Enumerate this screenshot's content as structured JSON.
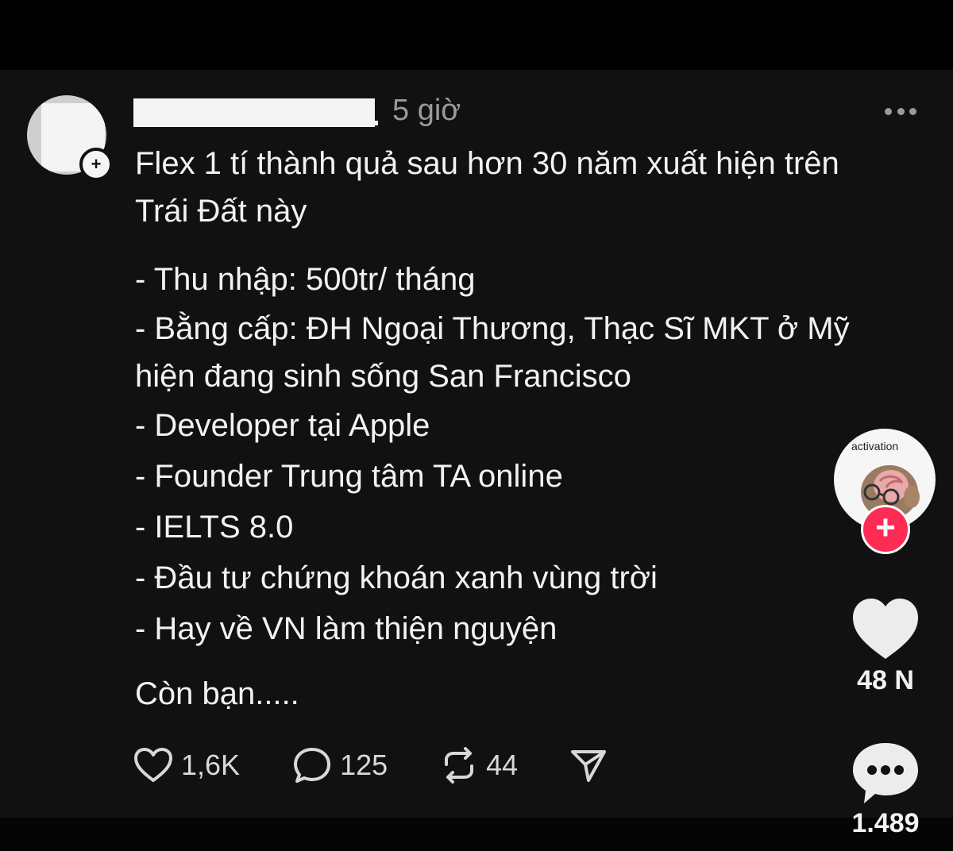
{
  "post": {
    "time": "5 giờ",
    "title_lines": [
      "Flex 1 tí thành quả sau hơn 30 năm xuất hiện trên",
      "Trái Đất này"
    ],
    "list_lines": [
      "- Thu nhập: 500tr/ tháng",
      "- Bằng cấp: ĐH Ngoại Thương, Thạc Sĩ MKT ở Mỹ",
      "hiện đang sinh sống San Francisco",
      "- Developer tại Apple",
      "- Founder Trung tâm TA online",
      "- IELTS 8.0",
      "- Đầu tư chứng khoán xanh vùng trời",
      "-  Hay về VN làm thiện nguyện"
    ],
    "outro": "Còn bạn.....",
    "actions": {
      "likes": "1,6K",
      "replies": "125",
      "reposts": "44"
    }
  },
  "sidebar": {
    "creator_caption": "activation",
    "likes": "48 N",
    "comments": "1.489"
  },
  "colors": {
    "background": "#000000",
    "card": "#111111",
    "text": "#f2f2f2",
    "muted": "#9a9a9a",
    "follow_accent": "#fe2c55"
  },
  "icons": [
    "more-icon",
    "heart-icon",
    "comment-icon",
    "repost-icon",
    "share-icon",
    "plus-icon",
    "chat-bubble-icon"
  ]
}
